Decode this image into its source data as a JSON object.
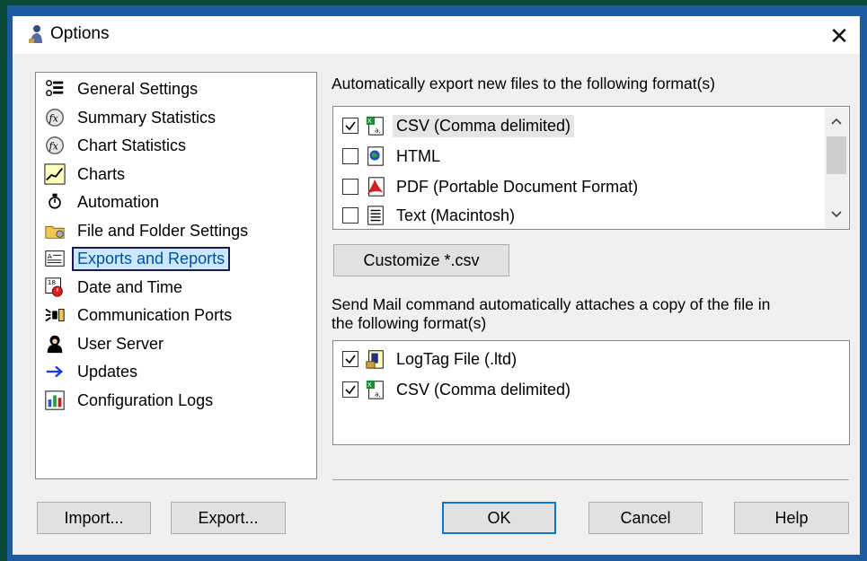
{
  "window": {
    "title": "Options",
    "close_glyph": "✕"
  },
  "nav": {
    "items": [
      {
        "label": "General Settings",
        "icon": "general-settings-icon"
      },
      {
        "label": "Summary Statistics",
        "icon": "summary-statistics-icon"
      },
      {
        "label": "Chart Statistics",
        "icon": "chart-statistics-icon"
      },
      {
        "label": "Charts",
        "icon": "charts-icon"
      },
      {
        "label": "Automation",
        "icon": "automation-icon"
      },
      {
        "label": "File and Folder Settings",
        "icon": "folder-settings-icon"
      },
      {
        "label": "Exports and Reports",
        "icon": "exports-reports-icon",
        "selected": true
      },
      {
        "label": "Date and Time",
        "icon": "calendar-clock-icon"
      },
      {
        "label": "Communication Ports",
        "icon": "communication-ports-icon"
      },
      {
        "label": "User Server",
        "icon": "user-server-icon"
      },
      {
        "label": "Updates",
        "icon": "arrow-right-icon"
      },
      {
        "label": "Configuration Logs",
        "icon": "configuration-logs-icon"
      }
    ]
  },
  "exports": {
    "heading": "Automatically export new files to the following format(s)",
    "formats": [
      {
        "label": "CSV (Comma delimited)",
        "checked": true,
        "icon": "csv-icon"
      },
      {
        "label": "HTML",
        "checked": false,
        "icon": "html-icon"
      },
      {
        "label": "PDF (Portable Document Format)",
        "checked": false,
        "icon": "pdf-icon"
      },
      {
        "label": "Text (Macintosh)",
        "checked": false,
        "icon": "text-file-icon"
      }
    ],
    "customize_label": "Customize *.csv"
  },
  "mail": {
    "heading_line1": "Send Mail command automatically attaches a copy of the file in",
    "heading_line2": "the following format(s)",
    "formats": [
      {
        "label": "LogTag File (.ltd)",
        "checked": true,
        "icon": "logtag-file-icon"
      },
      {
        "label": "CSV (Comma delimited)",
        "checked": true,
        "icon": "csv-icon"
      }
    ]
  },
  "buttons": {
    "import": "Import...",
    "export": "Export...",
    "ok": "OK",
    "cancel": "Cancel",
    "help": "Help"
  },
  "colors": {
    "selection_bg": "#cce8ff",
    "accent": "#0078d7",
    "frame": "#1e5b9e"
  }
}
